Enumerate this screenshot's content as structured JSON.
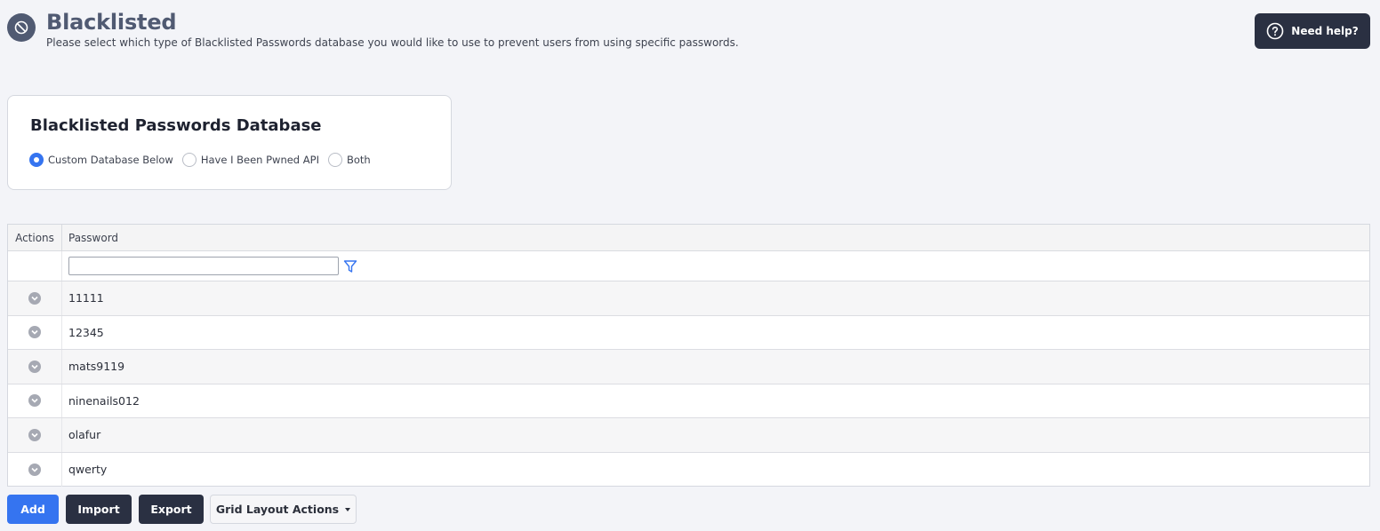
{
  "header": {
    "icon": "block-icon",
    "title": "Blacklisted",
    "subtitle": "Please select which type of Blacklisted Passwords database you would like to use to prevent users from using specific passwords.",
    "help_label": "Need help?"
  },
  "card": {
    "title": "Blacklisted Passwords Database",
    "options": [
      {
        "label": "Custom Database Below",
        "checked": true
      },
      {
        "label": "Have I Been Pwned API",
        "checked": false
      },
      {
        "label": "Both",
        "checked": false
      }
    ]
  },
  "grid": {
    "columns": {
      "actions": "Actions",
      "password": "Password"
    },
    "filter_value": "",
    "rows": [
      "11111",
      "12345",
      "mats9119",
      "ninenails012",
      "olafur",
      "qwerty"
    ]
  },
  "toolbar": {
    "add_label": "Add",
    "import_label": "Import",
    "export_label": "Export",
    "grid_layout_label": "Grid Layout Actions"
  },
  "colors": {
    "primary": "#3574f0",
    "dark": "#2a3042",
    "title": "#505a72"
  }
}
